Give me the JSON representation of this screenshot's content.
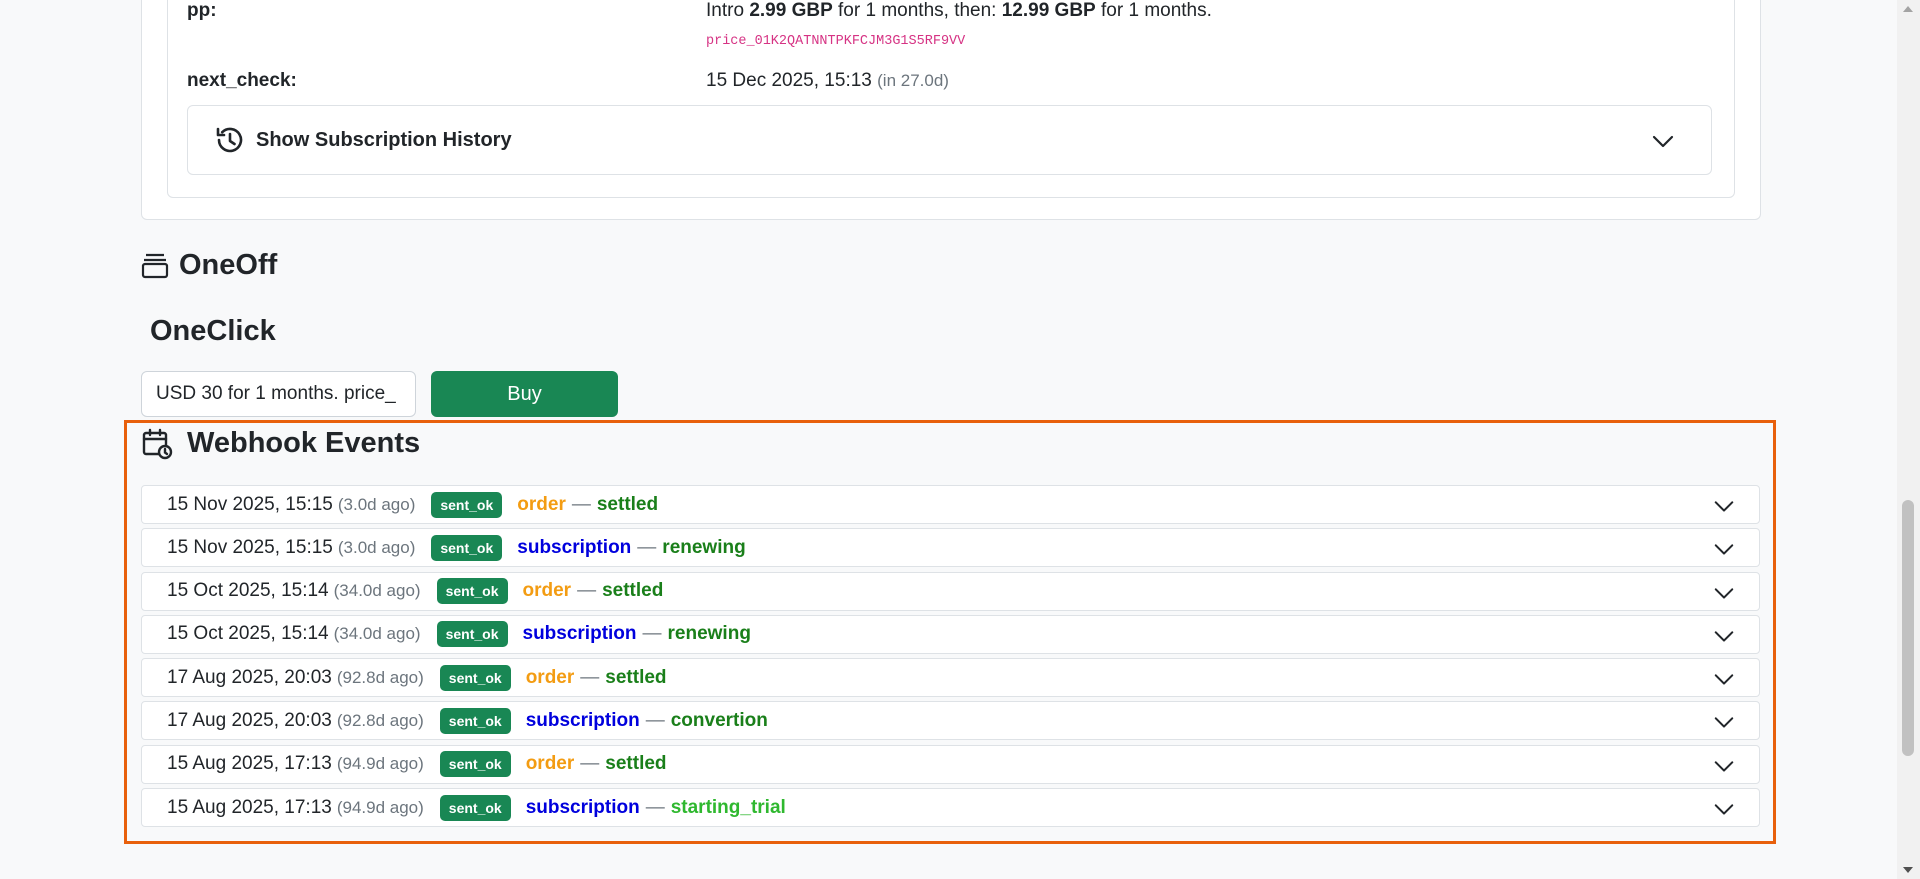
{
  "subscription": {
    "pp_label": "pp:",
    "pp_intro_prefix": "Intro",
    "pp_intro_price": "2.99 GBP",
    "pp_intro_mid": "for 1 months, then:",
    "pp_full_price": "12.99 GBP",
    "pp_suffix": "for 1 months.",
    "price_id": "price_01K2QATNNTPKFCJM3G1S5RF9VV",
    "next_check_label": "next_check:",
    "next_check_value": "15 Dec 2025, 15:13",
    "next_check_relative": "(in 27.0d)",
    "history_button_label": "Show Subscription History"
  },
  "oneoff": {
    "title": "OneOff",
    "oneclick_title": "OneClick",
    "select_value": "USD 30 for 1 months. price_",
    "buy_label": "Buy"
  },
  "webhooks": {
    "title": "Webhook Events",
    "dash": "—",
    "events": [
      {
        "date": "15 Nov 2025, 15:15",
        "ago": "(3.0d ago)",
        "badge": "sent_ok",
        "type": "order",
        "status": "settled"
      },
      {
        "date": "15 Nov 2025, 15:15",
        "ago": "(3.0d ago)",
        "badge": "sent_ok",
        "type": "subscription",
        "status": "renewing"
      },
      {
        "date": "15 Oct 2025, 15:14",
        "ago": "(34.0d ago)",
        "badge": "sent_ok",
        "type": "order",
        "status": "settled"
      },
      {
        "date": "15 Oct 2025, 15:14",
        "ago": "(34.0d ago)",
        "badge": "sent_ok",
        "type": "subscription",
        "status": "renewing"
      },
      {
        "date": "17 Aug 2025, 20:03",
        "ago": "(92.8d ago)",
        "badge": "sent_ok",
        "type": "order",
        "status": "settled"
      },
      {
        "date": "17 Aug 2025, 20:03",
        "ago": "(92.8d ago)",
        "badge": "sent_ok",
        "type": "subscription",
        "status": "convertion"
      },
      {
        "date": "15 Aug 2025, 17:13",
        "ago": "(94.9d ago)",
        "badge": "sent_ok",
        "type": "order",
        "status": "settled"
      },
      {
        "date": "15 Aug 2025, 17:13",
        "ago": "(94.9d ago)",
        "badge": "sent_ok",
        "type": "subscription",
        "status": "starting_trial"
      }
    ]
  },
  "colors": {
    "order": "#f39c12",
    "subscription": "#0000dd",
    "settled": "#1a7f1a",
    "renewing": "#1a7f1a",
    "convertion": "#1a7f1a",
    "starting_trial": "#2fb82f",
    "badge": "#198754",
    "highlight": "#e8600c"
  }
}
